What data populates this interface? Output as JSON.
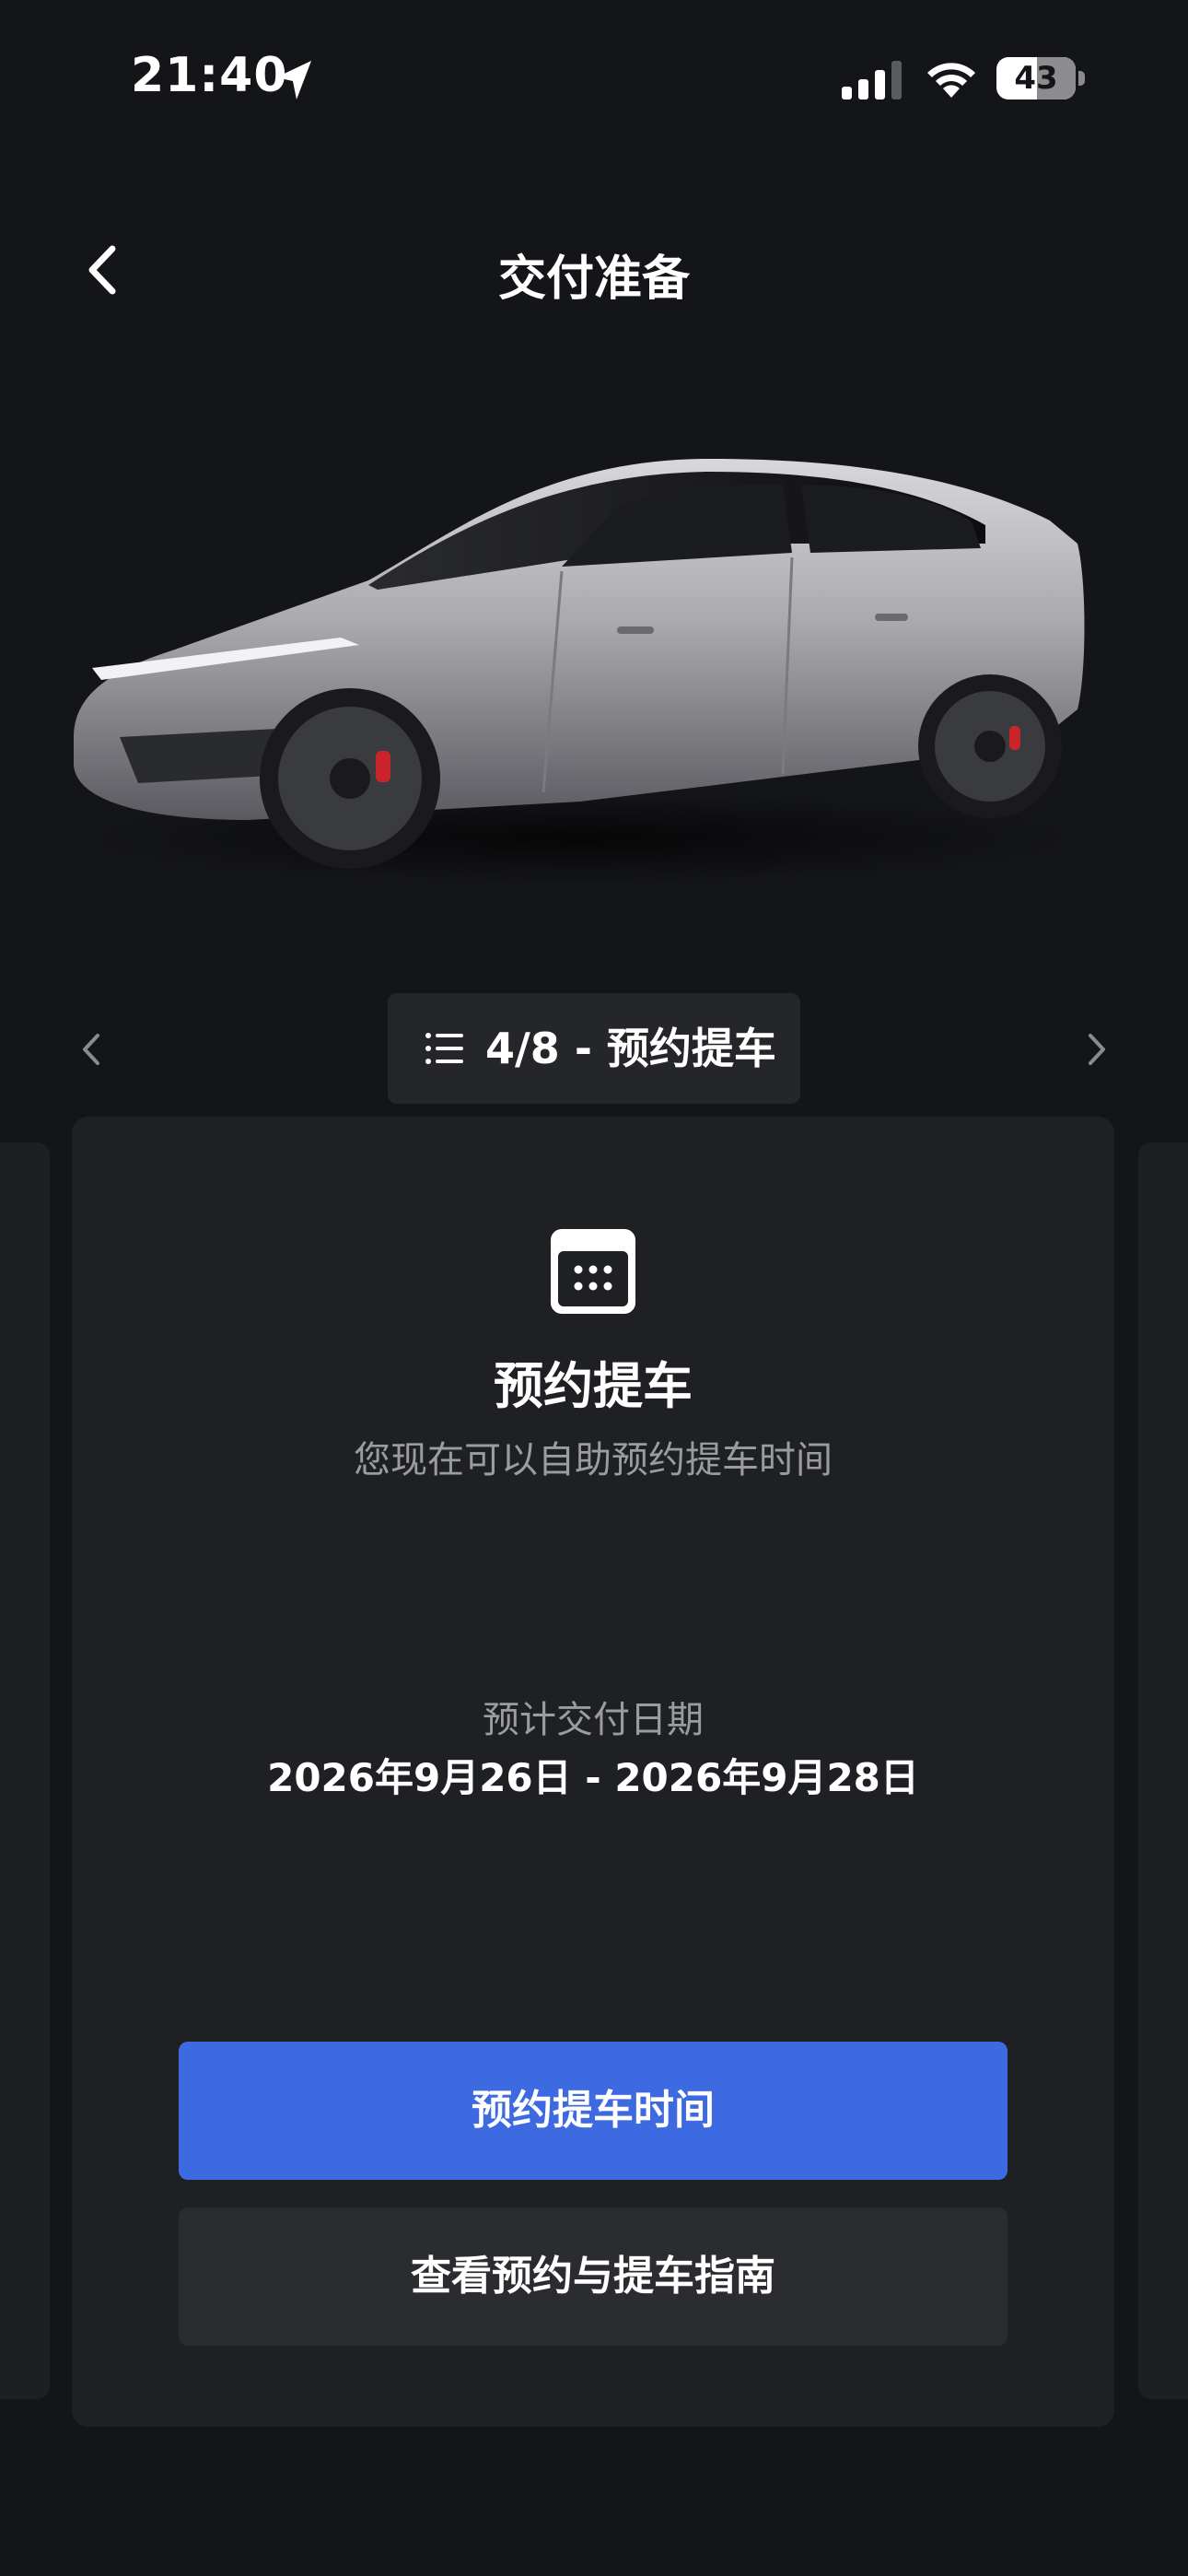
{
  "status_bar": {
    "time": "21:40",
    "battery_percent": "43",
    "icons": [
      "location-arrow-icon",
      "cellular-signal-icon",
      "wifi-icon",
      "battery-icon"
    ]
  },
  "header": {
    "title": "交付准备",
    "back_icon": "chevron-left-icon"
  },
  "vehicle": {
    "image": "silver-suv-illustration"
  },
  "step_nav": {
    "label": "4/8 - 预约提车",
    "prev_icon": "chevron-left-icon",
    "next_icon": "chevron-right-icon",
    "list_icon": "list-icon"
  },
  "card": {
    "icon": "calendar-icon",
    "title": "预约提车",
    "subtitle": "您现在可以自助预约提车时间",
    "delivery_label": "预计交付日期",
    "delivery_dates": "2026年9月26日 - 2026年9月28日",
    "primary_button": "预约提车时间",
    "secondary_button": "查看预约与提车指南"
  },
  "colors": {
    "background": "#141518",
    "card": "#1f2023",
    "primary": "#3e6ae1",
    "secondary_button": "#2b2c30",
    "muted_text": "#9b9c9f"
  }
}
